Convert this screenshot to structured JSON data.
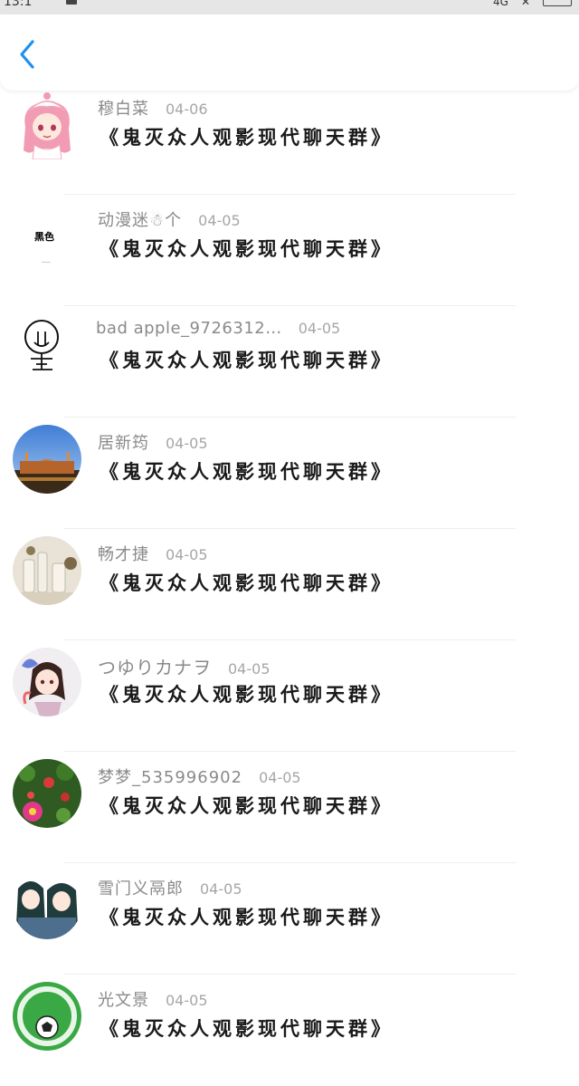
{
  "status_bar": {
    "time": "13:1",
    "network": "4G"
  },
  "header": {
    "back_icon": "chevron-left-icon",
    "accent_color": "#1e90f0"
  },
  "replies": [
    {
      "username": "穆白菜",
      "date": "04-06",
      "message": "《鬼灭众人观影现代聊天群》",
      "avatar": "anime-girl-pink-hair"
    },
    {
      "username": "动漫迷☃个",
      "date": "04-05",
      "message": "《鬼灭众人观影现代聊天群》",
      "avatar": "black-text-avatar",
      "avatar_text": "黑色"
    },
    {
      "username": "bad apple_9726312…",
      "date": "04-05",
      "message": "《鬼灭众人观影现代聊天群》",
      "avatar": "stick-figure-sketch"
    },
    {
      "username": "居新筠",
      "date": "04-05",
      "message": "《鬼灭众人观影现代聊天群》",
      "avatar": "mosque-photo"
    },
    {
      "username": "畅才捷",
      "date": "04-05",
      "message": "《鬼灭众人观影现代聊天群》",
      "avatar": "glass-bottles-photo"
    },
    {
      "username": "つゆりカナヲ",
      "date": "04-05",
      "message": "《鬼灭众人观影现代聊天群》",
      "avatar": "anime-girl-butterfly"
    },
    {
      "username": "梦梦_535996902",
      "date": "04-05",
      "message": "《鬼灭众人观影现代聊天群》",
      "avatar": "flowers-photo"
    },
    {
      "username": "雪门义鬲郎",
      "date": "04-05",
      "message": "《鬼灭众人观影现代聊天群》",
      "avatar": "anime-twins"
    },
    {
      "username": "光文景",
      "date": "04-05",
      "message": "《鬼灭众人观影现代聊天群》",
      "avatar": "soccer-ball-green"
    }
  ]
}
